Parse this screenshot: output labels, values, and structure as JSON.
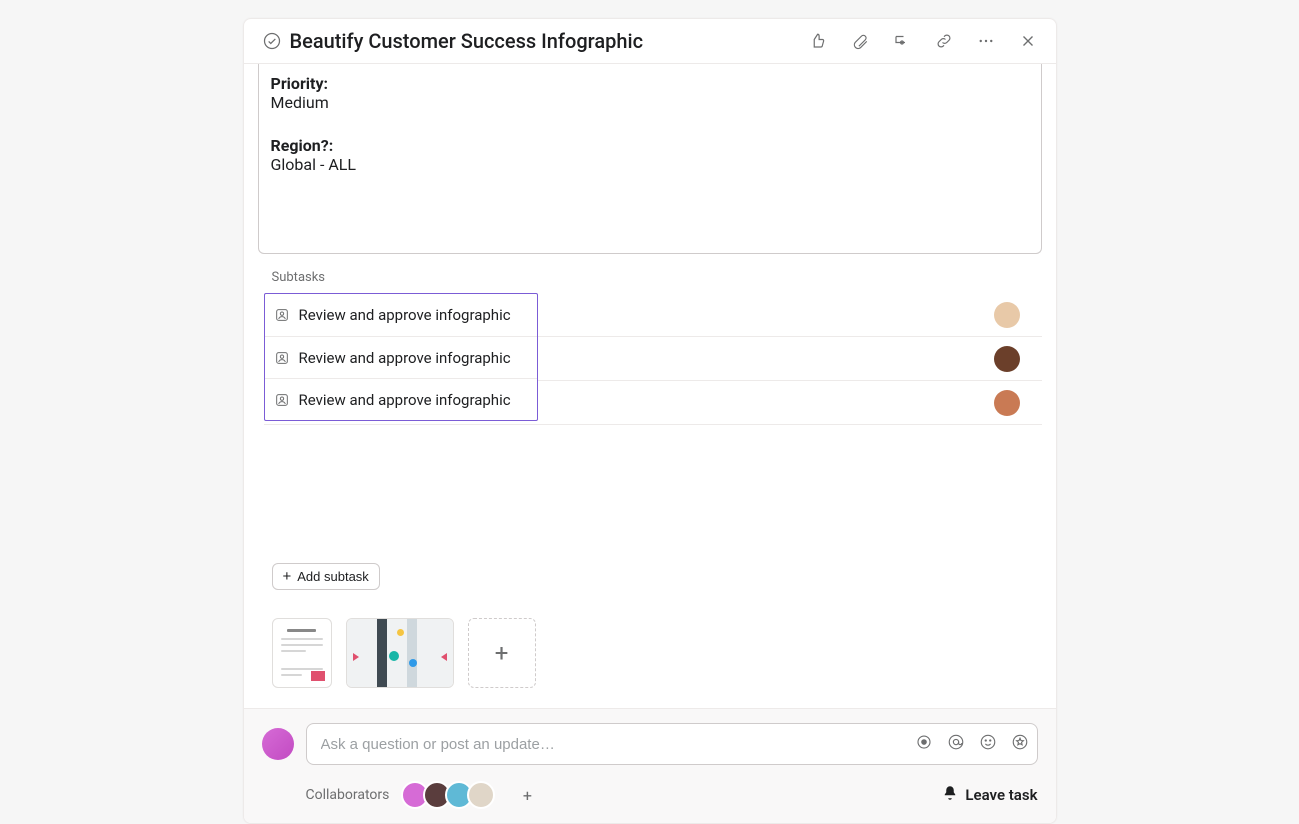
{
  "task": {
    "title": "Beautify Customer Success Infographic"
  },
  "description": {
    "fields": [
      {
        "label": "Priority:",
        "value": "Medium"
      },
      {
        "label": "Region?:",
        "value": "Global - ALL"
      }
    ]
  },
  "subtasks": {
    "section_label": "Subtasks",
    "items": [
      {
        "title": "Review and approve infographic",
        "assignee_color": "#e8c9a8"
      },
      {
        "title": "Review and approve infographic",
        "assignee_color": "#6b3f2a"
      },
      {
        "title": "Review and approve infographic",
        "assignee_color": "#c97a54"
      }
    ],
    "add_label": "Add subtask"
  },
  "attachments": {
    "items": [
      "doc-thumb",
      "flow-thumb"
    ],
    "add_icon": "+"
  },
  "comment": {
    "placeholder": "Ask a question or post an update…"
  },
  "collaborators": {
    "label": "Collaborators",
    "avatars": [
      "#d66bd6",
      "#5a3d3d",
      "#5fb9d6",
      "#e0d6c8"
    ],
    "add_icon": "+"
  },
  "leave_task_label": "Leave task"
}
